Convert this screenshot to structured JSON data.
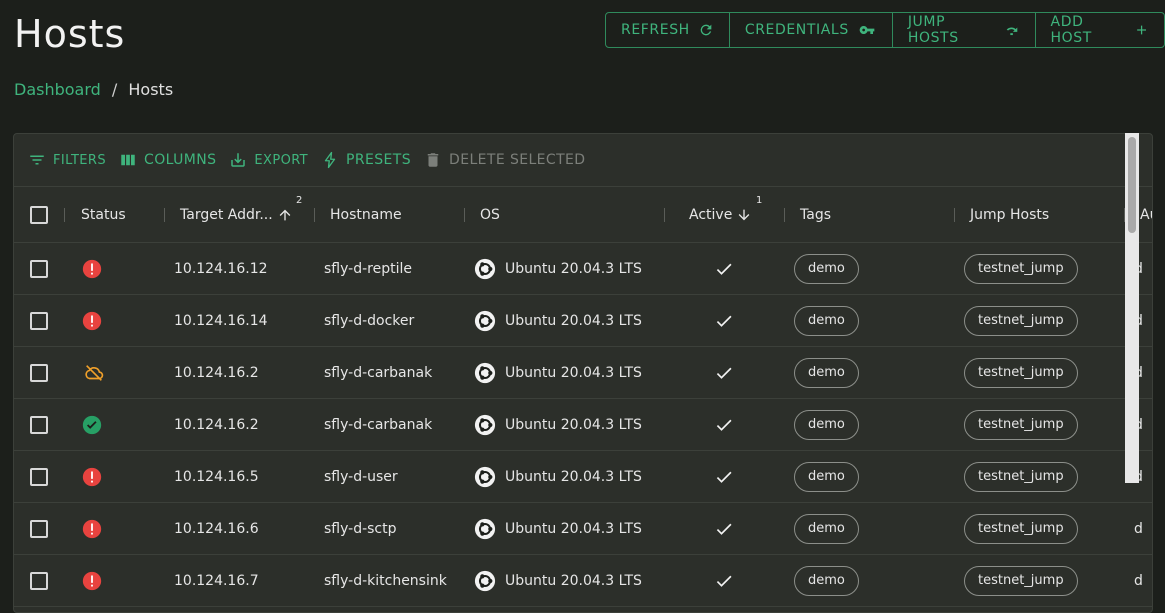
{
  "page": {
    "title": "Hosts"
  },
  "actions": [
    {
      "label": "REFRESH",
      "icon": "refresh-icon"
    },
    {
      "label": "CREDENTIALS",
      "icon": "key-icon"
    },
    {
      "label": "JUMP HOSTS",
      "icon": "redo-icon"
    },
    {
      "label": "ADD HOST",
      "icon": "plus-icon"
    }
  ],
  "breadcrumb": {
    "link": "Dashboard",
    "separator": "/",
    "current": "Hosts"
  },
  "toolbar": {
    "filters": "FILTERS",
    "columns": "COLUMNS",
    "export": "EXPORT",
    "presets": "PRESETS",
    "delete_selected": "DELETE SELECTED"
  },
  "columns": {
    "status": "Status",
    "target": "Target Addr...",
    "target_sort": "2",
    "hostname": "Hostname",
    "os": "OS",
    "active": "Active",
    "active_sort": "1",
    "tags": "Tags",
    "jump_hosts": "Jump Hosts",
    "cut": "Au"
  },
  "rows": [
    {
      "status": "error",
      "target": "10.124.16.12",
      "hostname": "sfly-d-reptile",
      "os": "Ubuntu 20.04.3 LTS",
      "tag": "demo",
      "jump": "testnet_jump",
      "cut": "d"
    },
    {
      "status": "error",
      "target": "10.124.16.14",
      "hostname": "sfly-d-docker",
      "os": "Ubuntu 20.04.3 LTS",
      "tag": "demo",
      "jump": "testnet_jump",
      "cut": "d"
    },
    {
      "status": "offline",
      "target": "10.124.16.2",
      "hostname": "sfly-d-carbanak",
      "os": "Ubuntu 20.04.3 LTS",
      "tag": "demo",
      "jump": "testnet_jump",
      "cut": "d"
    },
    {
      "status": "ok",
      "target": "10.124.16.2",
      "hostname": "sfly-d-carbanak",
      "os": "Ubuntu 20.04.3 LTS",
      "tag": "demo",
      "jump": "testnet_jump",
      "cut": "d"
    },
    {
      "status": "error",
      "target": "10.124.16.5",
      "hostname": "sfly-d-user",
      "os": "Ubuntu 20.04.3 LTS",
      "tag": "demo",
      "jump": "testnet_jump",
      "cut": "d"
    },
    {
      "status": "error",
      "target": "10.124.16.6",
      "hostname": "sfly-d-sctp",
      "os": "Ubuntu 20.04.3 LTS",
      "tag": "demo",
      "jump": "testnet_jump",
      "cut": "d"
    },
    {
      "status": "error",
      "target": "10.124.16.7",
      "hostname": "sfly-d-kitchensink",
      "os": "Ubuntu 20.04.3 LTS",
      "tag": "demo",
      "jump": "testnet_jump",
      "cut": "d"
    }
  ],
  "colors": {
    "accent": "#3fb47d",
    "error": "#e8433f",
    "ok": "#27a065",
    "warning": "#f0a02a",
    "background": "#1c1f1b",
    "panel": "#2c2f2a"
  }
}
